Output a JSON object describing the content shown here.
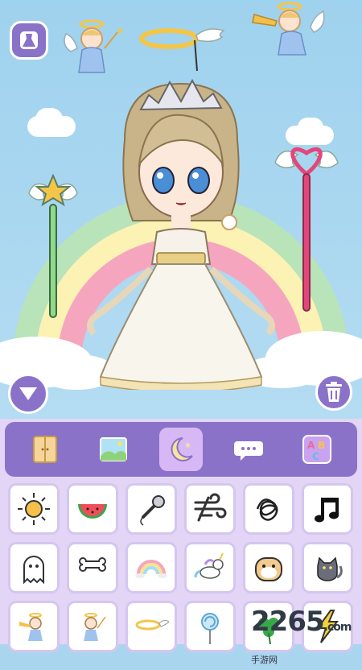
{
  "toolbar": {
    "tabs": [
      {
        "id": "wardrobe",
        "icon": "wardrobe-icon",
        "active": false
      },
      {
        "id": "background",
        "icon": "landscape-icon",
        "active": false
      },
      {
        "id": "decorations",
        "icon": "moon-star-icon",
        "active": true
      },
      {
        "id": "speech-bubbles",
        "icon": "speech-bubble-icon",
        "active": false
      },
      {
        "id": "letters",
        "icon": "abc-blocks-icon",
        "active": false
      }
    ]
  },
  "items": [
    "sun-icon",
    "watermelon-icon",
    "microphone-icon",
    "wind-icon",
    "scribble-icon",
    "music-note-icon",
    "ghost-icon",
    "bone-icon",
    "rainbow-icon",
    "unicorn-icon",
    "hamster-icon",
    "cat-icon",
    "cherub-trumpet-icon",
    "cherub-wand-icon",
    "halo-icon",
    "lollipop-icon",
    "clover-icon",
    "lightning-icon"
  ],
  "watermark": {
    "brand": "2265",
    "suffix": ".com",
    "sub": "手游网"
  },
  "colors": {
    "accent": "#8b72c9",
    "panel": "#e2d5f6",
    "sky": "#a9d6ee"
  }
}
